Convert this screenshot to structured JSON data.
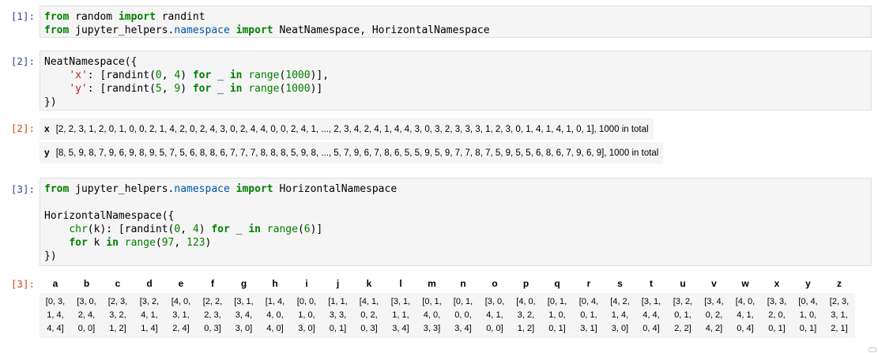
{
  "cells": [
    {
      "prompt": "[1]:",
      "lines": [
        [
          [
            "kw",
            "from"
          ],
          [
            "p",
            " random "
          ],
          [
            "kw",
            "import"
          ],
          [
            "p",
            " randint"
          ]
        ],
        [
          [
            "kw",
            "from"
          ],
          [
            "p",
            " jupyter_helpers."
          ],
          [
            "mod",
            "namespace"
          ],
          [
            "p",
            " "
          ],
          [
            "kw",
            "import"
          ],
          [
            "p",
            " NeatNamespace, HorizontalNamespace"
          ]
        ]
      ]
    },
    {
      "prompt": "[2]:",
      "lines": [
        [
          [
            "p",
            "NeatNamespace({"
          ]
        ],
        [
          [
            "p",
            "    "
          ],
          [
            "str",
            "'x'"
          ],
          [
            "p",
            ": [randint("
          ],
          [
            "num",
            "0"
          ],
          [
            "p",
            ", "
          ],
          [
            "num",
            "4"
          ],
          [
            "p",
            ") "
          ],
          [
            "kw",
            "for"
          ],
          [
            "p",
            " _ "
          ],
          [
            "kw",
            "in"
          ],
          [
            "p",
            " "
          ],
          [
            "bi",
            "range"
          ],
          [
            "p",
            "("
          ],
          [
            "num",
            "1000"
          ],
          [
            "p",
            ")],"
          ]
        ],
        [
          [
            "p",
            "    "
          ],
          [
            "str",
            "'y'"
          ],
          [
            "p",
            ": [randint("
          ],
          [
            "num",
            "5"
          ],
          [
            "p",
            ", "
          ],
          [
            "num",
            "9"
          ],
          [
            "p",
            ") "
          ],
          [
            "kw",
            "for"
          ],
          [
            "p",
            " _ "
          ],
          [
            "kw",
            "in"
          ],
          [
            "p",
            " "
          ],
          [
            "bi",
            "range"
          ],
          [
            "p",
            "("
          ],
          [
            "num",
            "1000"
          ],
          [
            "p",
            ")]"
          ]
        ],
        [
          [
            "p",
            "})"
          ]
        ]
      ]
    },
    {
      "prompt": "[3]:",
      "lines": [
        [
          [
            "kw",
            "from"
          ],
          [
            "p",
            " jupyter_helpers."
          ],
          [
            "mod",
            "namespace"
          ],
          [
            "p",
            " "
          ],
          [
            "kw",
            "import"
          ],
          [
            "p",
            " HorizontalNamespace"
          ]
        ],
        [
          [
            "p",
            ""
          ]
        ],
        [
          [
            "p",
            "HorizontalNamespace({"
          ]
        ],
        [
          [
            "p",
            "    "
          ],
          [
            "bi",
            "chr"
          ],
          [
            "p",
            "(k): [randint("
          ],
          [
            "num",
            "0"
          ],
          [
            "p",
            ", "
          ],
          [
            "num",
            "4"
          ],
          [
            "p",
            ") "
          ],
          [
            "kw",
            "for"
          ],
          [
            "p",
            " _ "
          ],
          [
            "kw",
            "in"
          ],
          [
            "p",
            " "
          ],
          [
            "bi",
            "range"
          ],
          [
            "p",
            "("
          ],
          [
            "num",
            "6"
          ],
          [
            "p",
            ")]"
          ]
        ],
        [
          [
            "p",
            "    "
          ],
          [
            "kw",
            "for"
          ],
          [
            "p",
            " k "
          ],
          [
            "kw",
            "in"
          ],
          [
            "p",
            " "
          ],
          [
            "bi",
            "range"
          ],
          [
            "p",
            "("
          ],
          [
            "num",
            "97"
          ],
          [
            "p",
            ", "
          ],
          [
            "num",
            "123"
          ],
          [
            "p",
            ")"
          ]
        ],
        [
          [
            "p",
            "})"
          ]
        ]
      ]
    }
  ],
  "out2": {
    "prompt": "[2]:",
    "rows": [
      {
        "key": "x",
        "value": "[2, 2, 3, 1, 2, 0, 1, 0, 0, 2, 1, 4, 2, 0, 2, 4, 3, 0, 2, 4, 4, 0, 0, 2, 4, 1, ..., 2, 3, 4, 2, 4, 1, 4, 4, 3, 0, 3, 2, 3, 3, 3, 1, 2, 3, 0, 1, 4, 1, 4, 1, 0, 1], 1000 in total"
      },
      {
        "key": "y",
        "value": "[8, 5, 9, 8, 7, 9, 6, 9, 8, 9, 5, 7, 5, 6, 8, 8, 6, 7, 7, 7, 8, 8, 8, 5, 9, 8, ..., 5, 7, 9, 6, 7, 8, 6, 5, 5, 9, 5, 9, 7, 7, 8, 7, 5, 9, 5, 5, 6, 8, 6, 7, 9, 6, 9], 1000 in total"
      }
    ]
  },
  "out3": {
    "prompt": "[3]:",
    "columns": [
      {
        "key": "a",
        "value": "[0, 3,\n1, 4,\n4, 4]"
      },
      {
        "key": "b",
        "value": "[3, 0,\n2, 4,\n0, 0]"
      },
      {
        "key": "c",
        "value": "[2, 3,\n3, 2,\n1, 2]"
      },
      {
        "key": "d",
        "value": "[3, 2,\n4, 1,\n1, 4]"
      },
      {
        "key": "e",
        "value": "[4, 0,\n3, 1,\n2, 4]"
      },
      {
        "key": "f",
        "value": "[2, 2,\n2, 3,\n0, 3]"
      },
      {
        "key": "g",
        "value": "[3, 1,\n3, 4,\n3, 0]"
      },
      {
        "key": "h",
        "value": "[1, 4,\n4, 0,\n4, 0]"
      },
      {
        "key": "i",
        "value": "[0, 0,\n1, 0,\n3, 0]"
      },
      {
        "key": "j",
        "value": "[1, 1,\n3, 3,\n0, 1]"
      },
      {
        "key": "k",
        "value": "[4, 1,\n0, 2,\n0, 3]"
      },
      {
        "key": "l",
        "value": "[3, 1,\n1, 1,\n3, 4]"
      },
      {
        "key": "m",
        "value": "[0, 1,\n4, 0,\n3, 3]"
      },
      {
        "key": "n",
        "value": "[0, 1,\n0, 0,\n3, 4]"
      },
      {
        "key": "o",
        "value": "[3, 0,\n4, 1,\n0, 0]"
      },
      {
        "key": "p",
        "value": "[4, 0,\n3, 2,\n1, 2]"
      },
      {
        "key": "q",
        "value": "[0, 1,\n1, 0,\n0, 1]"
      },
      {
        "key": "r",
        "value": "[0, 4,\n0, 1,\n3, 1]"
      },
      {
        "key": "s",
        "value": "[4, 2,\n1, 4,\n3, 0]"
      },
      {
        "key": "t",
        "value": "[3, 1,\n4, 4,\n0, 4]"
      },
      {
        "key": "u",
        "value": "[3, 2,\n0, 1,\n2, 2]"
      },
      {
        "key": "v",
        "value": "[3, 4,\n0, 2,\n4, 2]"
      },
      {
        "key": "w",
        "value": "[4, 0,\n4, 1,\n0, 4]"
      },
      {
        "key": "x",
        "value": "[3, 3,\n2, 0,\n0, 1]"
      },
      {
        "key": "y",
        "value": "[0, 4,\n1, 0,\n0, 1]"
      },
      {
        "key": "z",
        "value": "[2, 3,\n3, 1,\n2, 1]"
      }
    ]
  }
}
